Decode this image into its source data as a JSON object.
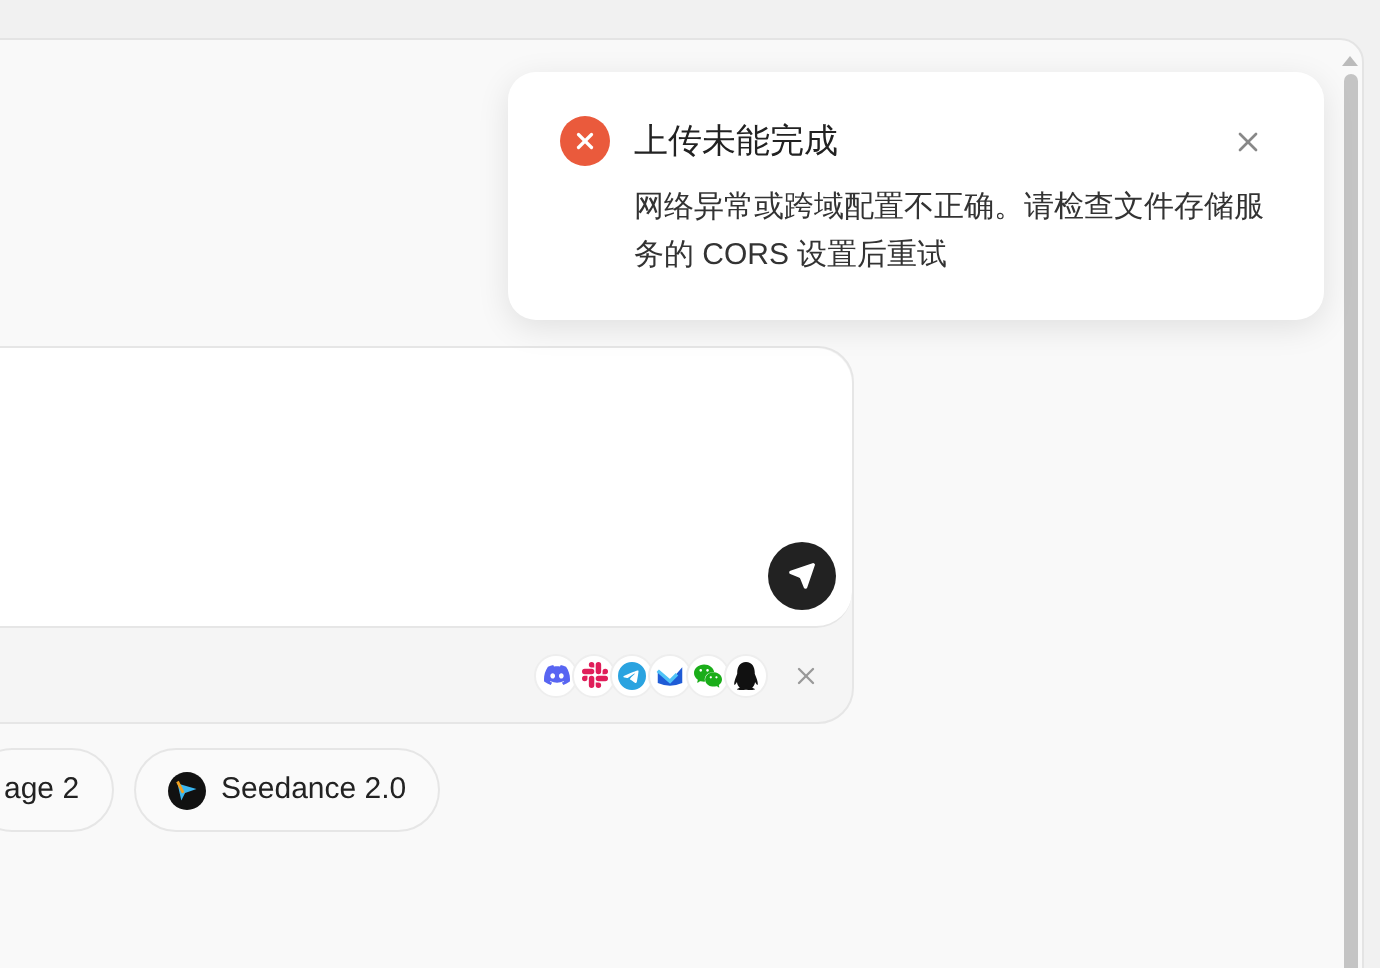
{
  "toast": {
    "title": "上传未能完成",
    "message": "网络异常或跨域配置不正确。请检查文件存储服务的 CORS 设置后重试"
  },
  "chips": [
    {
      "label": "age 2",
      "kind": "plain"
    },
    {
      "label": "Seedance 2.0",
      "kind": "logo"
    }
  ]
}
